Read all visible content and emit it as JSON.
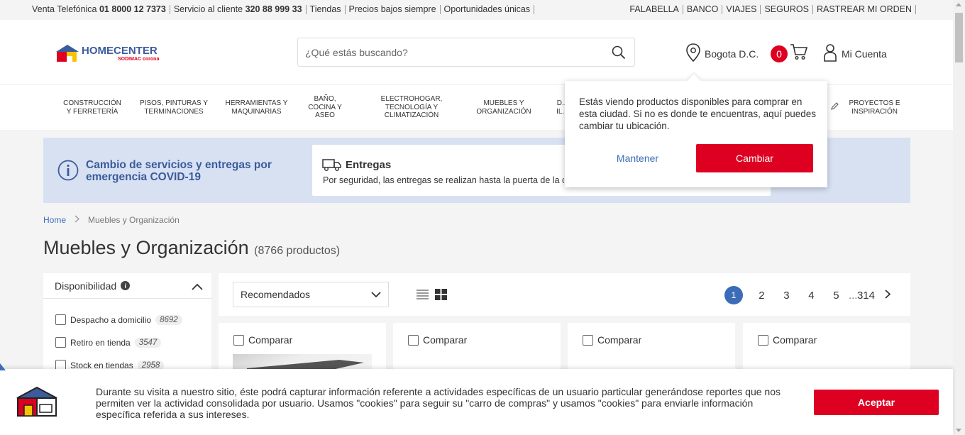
{
  "topbar": {
    "left": [
      {
        "label": "Venta Telefónica ",
        "strong": "01 8000 12 7373"
      },
      {
        "label": "Servicio al cliente ",
        "strong": "320 88 999 33"
      },
      {
        "label": "Tiendas",
        "strong": ""
      },
      {
        "label": "Precios bajos siempre",
        "strong": ""
      },
      {
        "label": "Oportunidades únicas",
        "strong": ""
      }
    ],
    "right": [
      "FALABELLA",
      "BANCO",
      "VIAJES",
      "SEGUROS",
      "RASTREAR MI ORDEN"
    ]
  },
  "header": {
    "logo_text": "HOMECENTER",
    "logo_sub": "SODIMAC corona",
    "search_placeholder": "¿Qué estás buscando?",
    "location": "Bogota D.C.",
    "cart_count": "0",
    "account_label": "Mi Cuenta"
  },
  "categories": [
    "CONSTRUCCIÓN Y FERRETERÍA",
    "PISOS, PINTURAS Y TERMINACIONES",
    "HERRAMIENTAS Y MAQUINARIAS",
    "BAÑO, COCINA Y ASEO",
    "ELECTROHOGAR, TECNOLOGÍA Y CLIMATIZACIÓN",
    "MUEBLES Y ORGANIZACIÓN",
    "D... IL...",
    "PROYECTOS E INSPIRACIÓN"
  ],
  "popup": {
    "message": "Estás viendo productos disponibles para comprar en esta ciudad. Si no es donde te encuentras, aquí puedes cambiar tu ubicación.",
    "keep_label": "Mantener",
    "change_label": "Cambiar"
  },
  "covid": {
    "title": "Cambio de servicios y entregas por emergencia COVID-19",
    "card_title": "Entregas",
    "card_text": "Por seguridad, las entregas se realizan hasta la puerta de la ca"
  },
  "breadcrumb": {
    "home": "Home",
    "current": "Muebles y Organización"
  },
  "page": {
    "title": "Muebles y Organización",
    "count": "(8766 productos)"
  },
  "filter": {
    "title": "Disponibilidad",
    "options": [
      {
        "label": "Despacho a domicilio",
        "count": "8692"
      },
      {
        "label": "Retiro en tienda",
        "count": "3547"
      },
      {
        "label": "Stock en tiendas",
        "count": "2958"
      }
    ]
  },
  "toolbar": {
    "sort_value": "Recomendados",
    "pages": [
      "1",
      "2",
      "3",
      "4",
      "5"
    ],
    "ellipsis": "...",
    "last_page": "314",
    "current_page": "1"
  },
  "products": {
    "compare_label": "Comparar"
  },
  "cookie": {
    "text": "Durante su visita a nuestro sitio, éste podrá capturar información referente a actividades específicas de un usuario particular generándose reportes que nos permiten ver la actividad consolidada por usuario. Usamos \"cookies\" para seguir su \"carro de compras\" y usamos \"cookies\" para enviarle información específica referida a sus intereses.",
    "accept_label": "Aceptar"
  },
  "colors": {
    "brand_red": "#dd0021",
    "brand_blue": "#3b6cb7",
    "banner_bg": "#d7e1f2"
  }
}
